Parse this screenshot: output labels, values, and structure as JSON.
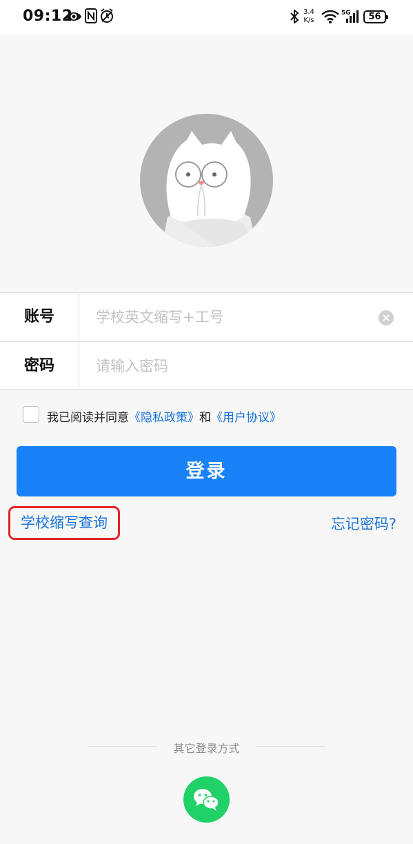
{
  "status_bar": {
    "time": "09:12",
    "net_speed_value": "3.4",
    "net_speed_unit": "K/s",
    "network_type": "5G",
    "battery": "56",
    "icons": [
      "eye-icon",
      "nfc-icon",
      "alarm-icon",
      "bluetooth-icon",
      "wifi-icon",
      "cellular-signal-icon",
      "battery-icon"
    ]
  },
  "form": {
    "account_label": "账号",
    "account_placeholder": "学校英文缩写+工号",
    "password_label": "密码",
    "password_placeholder": "请输入密码"
  },
  "agreement": {
    "prefix": "我已阅读并同意",
    "privacy_link": "《隐私政策》",
    "and": "和",
    "user_link": "《用户协议》"
  },
  "login_button": "登录",
  "school_query_link": "学校缩写查询",
  "forgot_password_link": "忘记密码?",
  "other_login": {
    "label": "其它登录方式",
    "wechat_icon": "wechat-icon"
  },
  "colors": {
    "primary": "#1a82f7",
    "link": "#1a73d9",
    "highlight_border": "#e3232a",
    "wechat_green": "#1fd166"
  }
}
